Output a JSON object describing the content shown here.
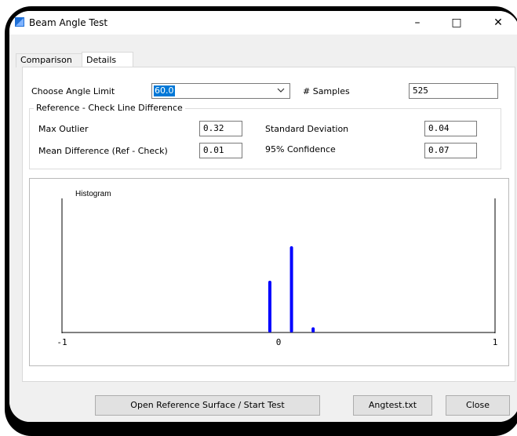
{
  "window": {
    "title": "Beam Angle Test",
    "minimize_glyph": "–",
    "maximize_glyph": "□",
    "close_glyph": "✕"
  },
  "tabs": [
    {
      "label": "Comparison",
      "active": false
    },
    {
      "label": "Details",
      "active": true
    }
  ],
  "angle_limit": {
    "label": "Choose Angle Limit",
    "value": "60.0"
  },
  "samples": {
    "label": "# Samples",
    "value": "525"
  },
  "group": {
    "title": "Reference - Check Line Difference",
    "max_outlier": {
      "label": "Max Outlier",
      "value": "0.32"
    },
    "mean_difference": {
      "label": "Mean Difference (Ref - Check)",
      "value": "0.01"
    },
    "std_dev": {
      "label": "Standard Deviation",
      "value": "0.04"
    },
    "confidence": {
      "label": "95% Confidence",
      "value": "0.07"
    }
  },
  "chart_data": {
    "type": "bar",
    "title": "Histogram",
    "xlim": [
      -1,
      1
    ],
    "x_ticks": [
      "-1",
      "0",
      "1"
    ],
    "bars": [
      {
        "x": -0.04,
        "value": 0.6
      },
      {
        "x": 0.06,
        "value": 1.0
      },
      {
        "x": 0.16,
        "value": 0.06
      }
    ],
    "bar_color": "#0000ff",
    "grid": false
  },
  "buttons": {
    "open_reference": "Open Reference Surface / Start Test",
    "angtest": "Angtest.txt",
    "close": "Close"
  },
  "colors": {
    "accent": "#0078d7",
    "bar": "#0000ff"
  }
}
